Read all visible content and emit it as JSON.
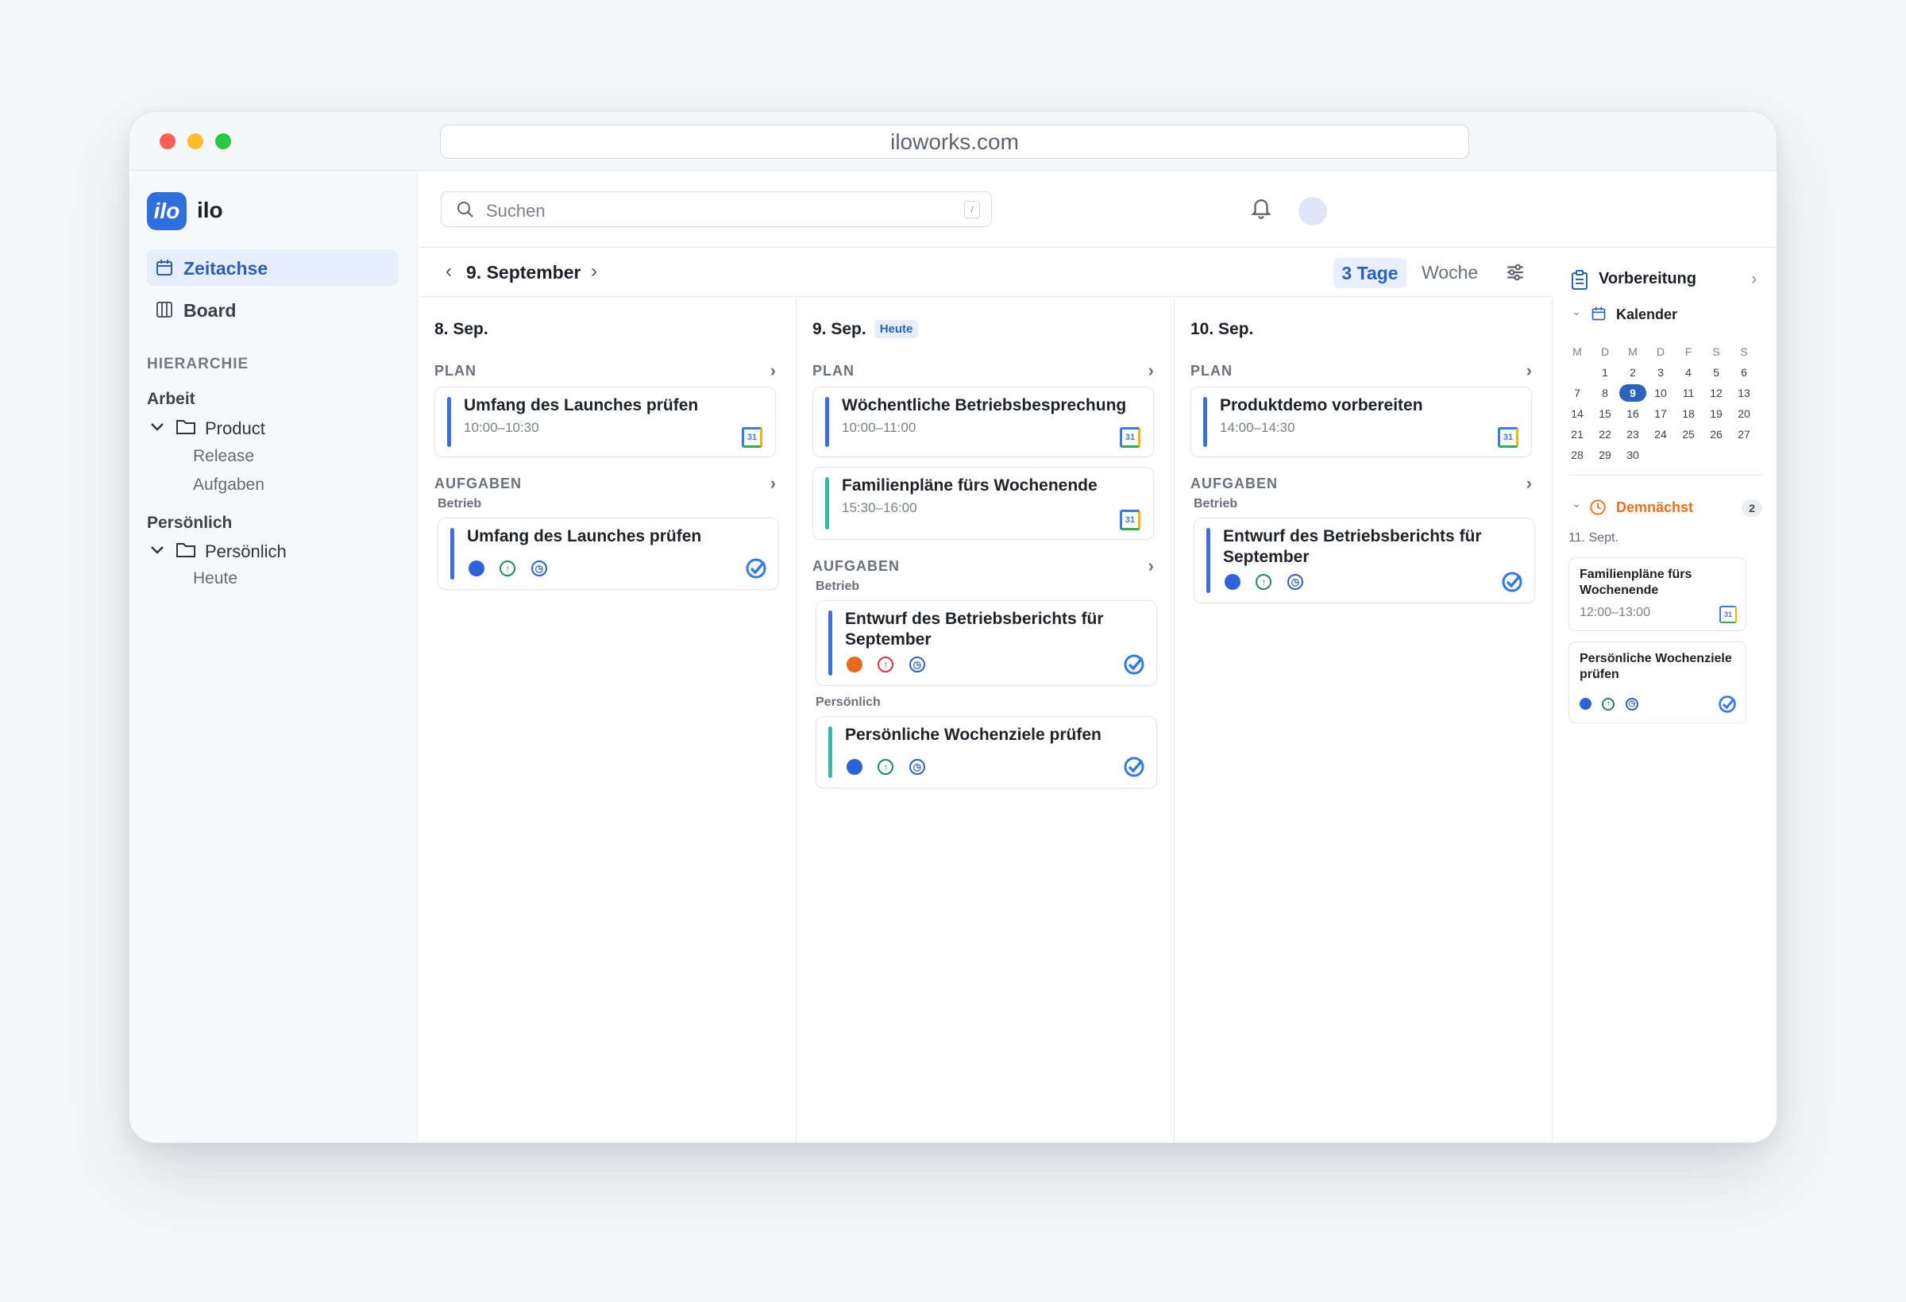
{
  "browser": {
    "url": "iloworks.com"
  },
  "app": {
    "logo_mark": "ilo",
    "name": "ilo"
  },
  "sidebar": {
    "nav": [
      {
        "label": "Zeitachse",
        "icon": "calendar-icon",
        "active": true
      },
      {
        "label": "Board",
        "icon": "columns-icon",
        "active": false
      }
    ],
    "hierarchy_label": "HIERARCHIE",
    "groups": [
      {
        "label": "Arbeit",
        "folder": "Product",
        "children": [
          "Release",
          "Aufgaben"
        ]
      },
      {
        "label": "Persönlich",
        "folder": "Persönlich",
        "children": [
          "Heute"
        ]
      }
    ]
  },
  "header": {
    "search_placeholder": "Suchen",
    "search_shortcut": "/"
  },
  "toolbar": {
    "current_date": "9. September",
    "view_3days": "3 Tage",
    "view_week": "Woche"
  },
  "days": [
    {
      "label": "8. Sep.",
      "plan_label": "PLAN",
      "plan": [
        {
          "title": "Umfang des Launches prüfen",
          "time": "10:00–10:30"
        }
      ],
      "tasks_label": "AUFGABEN",
      "task_groups": [
        {
          "category": "Betrieb",
          "tasks": [
            {
              "title": "Umfang des Launches prüfen"
            }
          ]
        }
      ]
    },
    {
      "label": "9. Sep.",
      "today_badge": "Heute",
      "plan_label": "PLAN",
      "plan": [
        {
          "title": "Wöchentliche Betriebsbesprechung",
          "time": "10:00–11:00"
        },
        {
          "title": "Familienpläne fürs Wochenende",
          "time": "15:30–16:00"
        }
      ],
      "tasks_label": "AUFGABEN",
      "task_groups": [
        {
          "category": "Betrieb",
          "tasks": [
            {
              "title": "Entwurf des Betriebsberichts für September"
            }
          ]
        },
        {
          "category": "Persönlich",
          "tasks": [
            {
              "title": "Persönliche Wochenziele prüfen"
            }
          ]
        }
      ]
    },
    {
      "label": "10. Sep.",
      "plan_label": "PLAN",
      "plan": [
        {
          "title": "Produktdemo vorbereiten",
          "time": "14:00–14:30"
        }
      ],
      "tasks_label": "AUFGABEN",
      "task_groups": [
        {
          "category": "Betrieb",
          "tasks": [
            {
              "title": "Entwurf des Betriebsberichts für September"
            }
          ]
        }
      ]
    }
  ],
  "right_panel": {
    "title": "Vorbereitung",
    "calendar_label": "Kalender",
    "weekdays": [
      "M",
      "D",
      "M",
      "D",
      "F",
      "S",
      "S"
    ],
    "weeks": [
      [
        "",
        "1",
        "2",
        "3",
        "4",
        "5",
        "6"
      ],
      [
        "7",
        "8",
        "9",
        "10",
        "11",
        "12",
        "13"
      ],
      [
        "14",
        "15",
        "16",
        "17",
        "18",
        "19",
        "20"
      ],
      [
        "21",
        "22",
        "23",
        "24",
        "25",
        "26",
        "27"
      ],
      [
        "28",
        "29",
        "30",
        "",
        "",
        "",
        ""
      ]
    ],
    "selected_day": "9",
    "upcoming_label": "Demnächst",
    "upcoming_count": "2",
    "upcoming_date": "11. Sept.",
    "upcoming": [
      {
        "title": "Familienpläne fürs Wochenende",
        "time": "12:00–13:00"
      },
      {
        "title": "Persönliche Wochenziele prüfen"
      }
    ]
  },
  "gcal_day": "31",
  "colors": {
    "accent": "#2d62bc",
    "blue_bar": "#3b6fe0",
    "teal_bar": "#3db8a8",
    "upcoming": "#e8711c"
  }
}
